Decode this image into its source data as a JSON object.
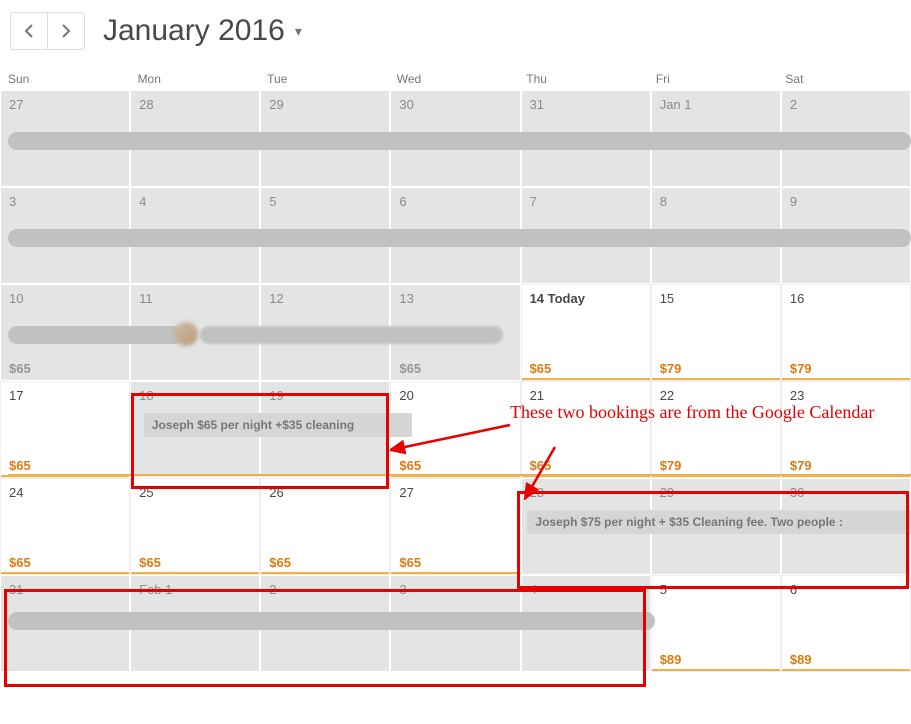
{
  "header": {
    "month_label": "January 2016"
  },
  "dow": [
    "Sun",
    "Mon",
    "Tue",
    "Wed",
    "Thu",
    "Fri",
    "Sat"
  ],
  "weeks": [
    [
      {
        "n": "27",
        "open": false,
        "price": "",
        "pc": ""
      },
      {
        "n": "28",
        "open": false,
        "price": "",
        "pc": ""
      },
      {
        "n": "29",
        "open": false,
        "price": "",
        "pc": ""
      },
      {
        "n": "30",
        "open": false,
        "price": "",
        "pc": ""
      },
      {
        "n": "31",
        "open": false,
        "price": "",
        "pc": ""
      },
      {
        "n": "Jan 1",
        "open": false,
        "price": "",
        "pc": ""
      },
      {
        "n": "2",
        "open": false,
        "price": "",
        "pc": ""
      }
    ],
    [
      {
        "n": "3",
        "open": false,
        "price": "",
        "pc": ""
      },
      {
        "n": "4",
        "open": false,
        "price": "",
        "pc": ""
      },
      {
        "n": "5",
        "open": false,
        "price": "",
        "pc": ""
      },
      {
        "n": "6",
        "open": false,
        "price": "",
        "pc": ""
      },
      {
        "n": "7",
        "open": false,
        "price": "",
        "pc": ""
      },
      {
        "n": "8",
        "open": false,
        "price": "",
        "pc": ""
      },
      {
        "n": "9",
        "open": false,
        "price": "",
        "pc": ""
      }
    ],
    [
      {
        "n": "10",
        "open": false,
        "price": "$65",
        "pc": "g"
      },
      {
        "n": "11",
        "open": false,
        "price": "",
        "pc": ""
      },
      {
        "n": "12",
        "open": false,
        "price": "",
        "pc": ""
      },
      {
        "n": "13",
        "open": false,
        "price": "$65",
        "pc": "g"
      },
      {
        "n": "14 Today",
        "open": true,
        "price": "$65",
        "pc": "o",
        "today": true
      },
      {
        "n": "15",
        "open": true,
        "price": "$79",
        "pc": "o"
      },
      {
        "n": "16",
        "open": true,
        "price": "$79",
        "pc": "o"
      }
    ],
    [
      {
        "n": "17",
        "open": true,
        "price": "$65",
        "pc": "o"
      },
      {
        "n": "18",
        "open": false,
        "price": "",
        "pc": ""
      },
      {
        "n": "19",
        "open": false,
        "price": "",
        "pc": ""
      },
      {
        "n": "20",
        "open": true,
        "price": "$65",
        "pc": "o"
      },
      {
        "n": "21",
        "open": true,
        "price": "$65",
        "pc": "o"
      },
      {
        "n": "22",
        "open": true,
        "price": "$79",
        "pc": "o"
      },
      {
        "n": "23",
        "open": true,
        "price": "$79",
        "pc": "o"
      }
    ],
    [
      {
        "n": "24",
        "open": true,
        "price": "$65",
        "pc": "o"
      },
      {
        "n": "25",
        "open": true,
        "price": "$65",
        "pc": "o"
      },
      {
        "n": "26",
        "open": true,
        "price": "$65",
        "pc": "o"
      },
      {
        "n": "27",
        "open": true,
        "price": "$65",
        "pc": "o"
      },
      {
        "n": "28",
        "open": false,
        "price": "",
        "pc": ""
      },
      {
        "n": "29",
        "open": false,
        "price": "",
        "pc": ""
      },
      {
        "n": "30",
        "open": false,
        "price": "",
        "pc": ""
      }
    ],
    [
      {
        "n": "31",
        "open": false,
        "price": "",
        "pc": ""
      },
      {
        "n": "Feb 1",
        "open": false,
        "price": "",
        "pc": ""
      },
      {
        "n": "2",
        "open": false,
        "price": "",
        "pc": ""
      },
      {
        "n": "3",
        "open": false,
        "price": "",
        "pc": ""
      },
      {
        "n": "4",
        "open": false,
        "price": "",
        "pc": ""
      },
      {
        "n": "5",
        "open": true,
        "price": "$89",
        "pc": "o"
      },
      {
        "n": "6",
        "open": true,
        "price": "$89",
        "pc": "o"
      }
    ]
  ],
  "events": {
    "row3_booking": "Joseph $65 per night +$35 cleaning",
    "row4_booking": "Joseph $75 per night + $35 Cleaning fee. Two people :"
  },
  "annotation": {
    "text": "These two bookings are from the Google Calendar"
  }
}
